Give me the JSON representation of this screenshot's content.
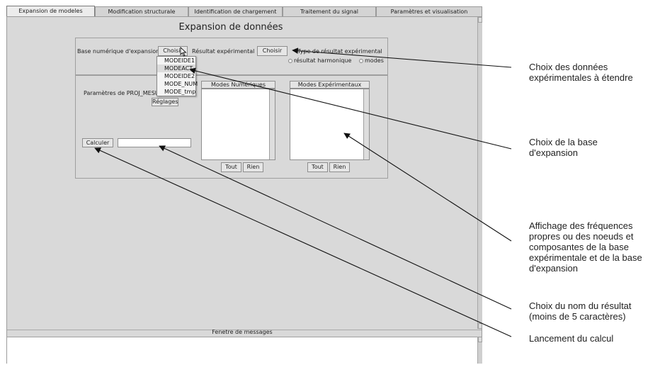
{
  "tabs": [
    {
      "label": "Expansion de modeles",
      "active": true
    },
    {
      "label": "Modification structurale",
      "active": false
    },
    {
      "label": "Identification de chargement",
      "active": false
    },
    {
      "label": "Traitement du signal",
      "active": false
    },
    {
      "label": "Paramètres et visualisation",
      "active": false
    }
  ],
  "main": {
    "title": "Expansion de données",
    "base_label": "Base numérique d'expansion",
    "base_button": "Choisir",
    "result_label": "Résultat expérimental",
    "result_button": "Choisir",
    "type_label": "Type de résultat expérimental",
    "radio_harmonic": "résultat harmonique",
    "radio_modes": "modes",
    "params_label": "Paramètres de PROJ_MESU_",
    "settings_button": "Réglages",
    "compute_button": "Calculer",
    "result_name_value": "",
    "num_modes": {
      "title": "Modes Numériques",
      "all_button": "Tout",
      "none_button": "Rien"
    },
    "exp_modes": {
      "title": "Modes Expérimentaux",
      "all_button": "Tout",
      "none_button": "Rien"
    },
    "messages_label": "Fenetre de messages"
  },
  "dropdown": {
    "items": [
      "MODEIDE1",
      "MODEACT",
      "MODEIDE2",
      "MODE_NUM",
      "MODE_tmp"
    ],
    "hovered_index": 1
  },
  "annotations": {
    "a1": "Choix des données expérimentales à étendre",
    "a2": "Choix de la base d'expansion",
    "a3": "Affichage des fréquences propres ou des noeuds et composantes de la base expérimentale et de la base d'expansion",
    "a4": "Choix du nom du résultat (moins de 5 caractères)",
    "a5": "Lancement du calcul"
  },
  "colors": {
    "window_bg": "#d9d9d9",
    "annotation_line": "#111111"
  }
}
